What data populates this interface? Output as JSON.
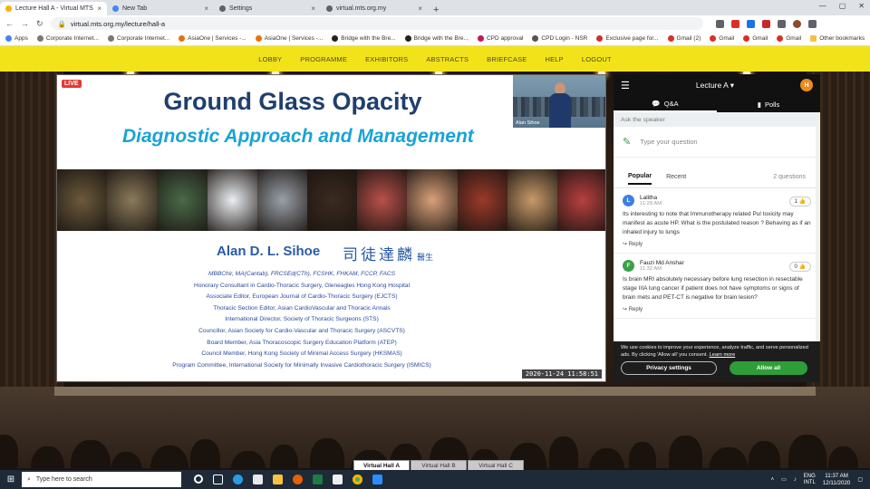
{
  "browser": {
    "tabs": [
      {
        "title": "Lecture Hall A - Virtual MTS",
        "active": true,
        "color": "#f4b400"
      },
      {
        "title": "New Tab",
        "active": false,
        "color": "#4285f4"
      },
      {
        "title": "Settings",
        "active": false,
        "color": "#5f6368"
      },
      {
        "title": "virtual.mts.org.my",
        "active": false,
        "color": "#5f6368"
      }
    ],
    "url": "virtual.mts.org.my/lecture/hall-a",
    "bookmarks": [
      {
        "label": "Apps",
        "color": "#4285f4"
      },
      {
        "label": "Corporate Internet...",
        "color": "#777777"
      },
      {
        "label": "Corporate Internet...",
        "color": "#777777"
      },
      {
        "label": "AsiaOne | Services -...",
        "color": "#e8710a"
      },
      {
        "label": "AsiaOne | Services -...",
        "color": "#e8710a"
      },
      {
        "label": "Bridge with the Bre...",
        "color": "#222222"
      },
      {
        "label": "Bridge with the Bre...",
        "color": "#222222"
      },
      {
        "label": "CPD approval",
        "color": "#c2185b"
      },
      {
        "label": "CPD Login - NSR",
        "color": "#555555"
      },
      {
        "label": "Exclusive page for...",
        "color": "#d32f2f"
      },
      {
        "label": "Gmail (2)",
        "color": "#d93025"
      },
      {
        "label": "Gmail",
        "color": "#d93025"
      },
      {
        "label": "Gmail",
        "color": "#d93025"
      },
      {
        "label": "Gmail",
        "color": "#d93025"
      }
    ],
    "other_bookmarks": "Other bookmarks"
  },
  "nav": {
    "items": [
      "LOBBY",
      "PROGRAMME",
      "EXHIBITORS",
      "ABSTRACTS",
      "BRIEFCASE",
      "HELP",
      "LOGOUT"
    ]
  },
  "slide": {
    "live_badge": "LIVE",
    "title": "Ground Glass Opacity",
    "subtitle": "Diagnostic Approach and Management",
    "speaker_cam_name": "Alan Sihoe",
    "author": "Alan D. L. Sihoe",
    "author_chinese": "司徒達麟",
    "author_title_cn": "醫生",
    "credentials": [
      {
        "text": "MBBChir, MA(Cantab), FRCSEd(CTh), FCSHK, FHKAM, FCCP, FACS",
        "italic": true
      },
      {
        "text": "Honorary Consultant in Cardio-Thoracic Surgery, Gleneagles Hong Kong Hospital",
        "italic": false
      },
      {
        "text": "Associate Editor, European Journal of Cardio-Thoracic Surgery (EJCTS)",
        "italic": false
      },
      {
        "text": "Thoracic Section Editor, Asian CardioVascular and Thoracic Annals",
        "italic": false
      },
      {
        "text": "International Director, Society of Thoracic Surgeons (STS)",
        "italic": false
      },
      {
        "text": "Councillor, Asian Society for Cardio-Vascular and Thoracic Surgery (ASCVTS)",
        "italic": false
      },
      {
        "text": "Board Member, Asia Thoracoscopic Surgery Education Platform (ATEP)",
        "italic": false
      },
      {
        "text": "Council Member, Hong Kong Society of Minimal Access Surgery (HKSMAS)",
        "italic": false
      },
      {
        "text": "Program Committee, International Society for Minimally Invasive Cardiothoracic Surgery (ISMICS)",
        "italic": false
      }
    ],
    "timestamp": "2020-11-24 11:58:51",
    "photo_colors": [
      "#6b5a3c",
      "#8a7a5a",
      "#4a6a4a",
      "#eaeef2",
      "#9aa0a8",
      "#3b2a20",
      "#b8504a",
      "#d9a07a",
      "#9a3a2a",
      "#c89a6a",
      "#b84040"
    ]
  },
  "qa": {
    "title": "Lecture A",
    "avatar": "H",
    "tabs": [
      "Q&A",
      "Polls"
    ],
    "ask_label": "Ask the speaker",
    "input_placeholder": "Type your question",
    "sort": [
      "Popular",
      "Recent"
    ],
    "count": "2 questions",
    "questions": [
      {
        "initial": "L",
        "color": "#3f7fe0",
        "name": "Lalitha",
        "time": "11:29 AM",
        "likes": "1",
        "text": "Its interesting to note that Immunotherapy related Pul toxicity may manifest as acute HP. What is the postulated reason ? Behaving as if an inhaled injury to lungs",
        "reply": "Reply"
      },
      {
        "initial": "F",
        "color": "#3aa048",
        "name": "Fauzi Md Anshar",
        "time": "11:32 AM",
        "likes": "0",
        "text": "Is brain MRI absolutely necessary before lung resection in resectable stage IIIA lung cancer if patient does not have symptoms or signs of brain mets and PET-CT is negative for brain lesion?",
        "reply": "Reply"
      }
    ],
    "cookie": {
      "text": "We use cookies to improve your experience, analyze traffic, and serve personalized ads. By clicking 'Allow all' you consent.",
      "link": "Learn more",
      "settings": "Privacy settings",
      "allow": "Allow all"
    }
  },
  "halls": [
    "Virtual Hall A",
    "Virtual Hall B",
    "Virtual Hall C"
  ],
  "taskbar": {
    "search": "Type here to search",
    "lang": "ENG",
    "lang2": "INTL",
    "time": "11:37 AM",
    "date": "12/11/2020"
  }
}
